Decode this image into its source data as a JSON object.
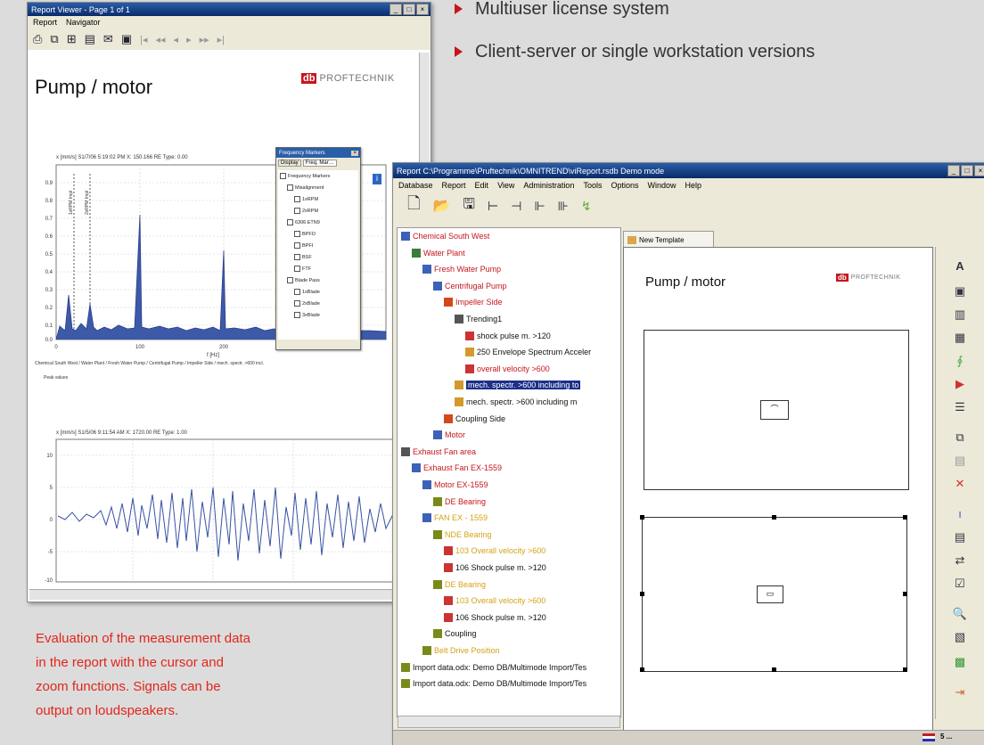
{
  "bullets": [
    "Multiuser license system",
    "Client-server or single workstation versions"
  ],
  "caption": [
    "Evaluation of the measurement data",
    "in the report with the cursor and",
    "zoom functions. Signals can be",
    "output on loudspeakers."
  ],
  "viewer": {
    "title": "Report Viewer - Page 1 of 1",
    "menu": [
      "Report",
      "Navigator"
    ],
    "page_title": "Pump / motor",
    "brand_db": "db",
    "brand_name": "PROFTECHNIK",
    "chart1_header": "x [mm/s]  S1/7/06 5:19:02 PM  X: 150.166  RE Type: 0.00",
    "chart1_xlabel": "f [Hz]",
    "chart1_path": "Chemical South West / Water Plant / Fresh Water Pump / Centrifugal Pump / Impeller Side / mech. spectr. >600 incl.",
    "chart1_sub": "Peak values",
    "chart2_header": "x [mm/s]  S1/5/06 9:11:54 AM  X: 1720.00  RE Type: 1.00",
    "markers": [
      "1xRPM Impl",
      "2xRPM Impl"
    ],
    "y1_ticks": [
      "0.9",
      "0.8",
      "0.7",
      "0.6",
      "0.5",
      "0.4",
      "0.3",
      "0.2",
      "0.1",
      "0.0"
    ],
    "x1_ticks": [
      "0",
      "100",
      "200",
      "300"
    ],
    "y2_ticks": [
      "10",
      "5",
      "0",
      "-5",
      "-10"
    ],
    "freq_popup": {
      "title": "Frequency Markers",
      "tabs": [
        "Display",
        "Freq. Mar…"
      ],
      "items": [
        {
          "label": "Frequency Markers",
          "indent": 0
        },
        {
          "label": "Misalignment",
          "indent": 1
        },
        {
          "label": "1xRPM",
          "indent": 2
        },
        {
          "label": "2xRPM",
          "indent": 2
        },
        {
          "label": "6306 ETN9",
          "indent": 1
        },
        {
          "label": "BPFO",
          "indent": 2
        },
        {
          "label": "BPFI",
          "indent": 2
        },
        {
          "label": "BSF",
          "indent": 2
        },
        {
          "label": "FTF",
          "indent": 2
        },
        {
          "label": "Blade Pass",
          "indent": 1
        },
        {
          "label": "1xBlade",
          "indent": 2
        },
        {
          "label": "2xBlade",
          "indent": 2
        },
        {
          "label": "3xBlade",
          "indent": 2
        }
      ]
    }
  },
  "main": {
    "title": "Report C:\\Programme\\Pruftechnik\\OMNITREND\\viReport.rsdb  Demo mode",
    "menu": [
      "Database",
      "Report",
      "Edit",
      "View",
      "Administration",
      "Tools",
      "Options",
      "Window",
      "Help"
    ],
    "tab_label": "New Template",
    "page_title": "Pump / motor",
    "brand_db": "db",
    "brand_name": "PROFTECHNIK",
    "tree": [
      {
        "label": "Chemical South West",
        "level": 0,
        "color": "red"
      },
      {
        "label": "Water Plant",
        "level": 1,
        "color": "red"
      },
      {
        "label": "Fresh Water Pump",
        "level": 2,
        "color": "red"
      },
      {
        "label": "Centrifugal Pump",
        "level": 3,
        "color": "red"
      },
      {
        "label": "Impeller Side",
        "level": 4,
        "color": "red"
      },
      {
        "label": "Trending1",
        "level": 5,
        "color": "black"
      },
      {
        "label": "shock pulse m. >120",
        "level": 6,
        "color": "black"
      },
      {
        "label": "250 Envelope Spectrum Acceler",
        "level": 6,
        "color": "black"
      },
      {
        "label": "overall velocity >600",
        "level": 6,
        "color": "red"
      },
      {
        "label": "mech. spectr. >600 including to",
        "level": 5,
        "color": "sel"
      },
      {
        "label": "mech. spectr. >600 including m",
        "level": 5,
        "color": "black"
      },
      {
        "label": "Coupling Side",
        "level": 4,
        "color": "black"
      },
      {
        "label": "Motor",
        "level": 3,
        "color": "red"
      },
      {
        "label": "Exhaust Fan area",
        "level": 0,
        "color": "red"
      },
      {
        "label": "Exhaust Fan EX-1559",
        "level": 1,
        "color": "red"
      },
      {
        "label": "Motor EX-1559",
        "level": 2,
        "color": "red"
      },
      {
        "label": "DE Bearing",
        "level": 3,
        "color": "red"
      },
      {
        "label": "FAN EX - 1559",
        "level": 2,
        "color": "yellow"
      },
      {
        "label": "NDE Bearing",
        "level": 3,
        "color": "yellow"
      },
      {
        "label": "103 Overall velocity >600",
        "level": 4,
        "color": "yellow"
      },
      {
        "label": "106 Shock pulse m. >120",
        "level": 4,
        "color": "black"
      },
      {
        "label": "DE Bearing",
        "level": 3,
        "color": "yellow"
      },
      {
        "label": "103 Overall velocity >600",
        "level": 4,
        "color": "yellow"
      },
      {
        "label": "106 Shock pulse m. >120",
        "level": 4,
        "color": "black"
      },
      {
        "label": "Coupling",
        "level": 3,
        "color": "black"
      },
      {
        "label": "Belt Drive Position",
        "level": 2,
        "color": "yellow"
      },
      {
        "label": "Import data.odx: Demo DB/Multimode Import/Tes",
        "level": 0,
        "color": "black"
      },
      {
        "label": "Import data.odx: Demo DB/Multimode Import/Tes",
        "level": 0,
        "color": "black"
      }
    ],
    "status": "5 ..."
  }
}
